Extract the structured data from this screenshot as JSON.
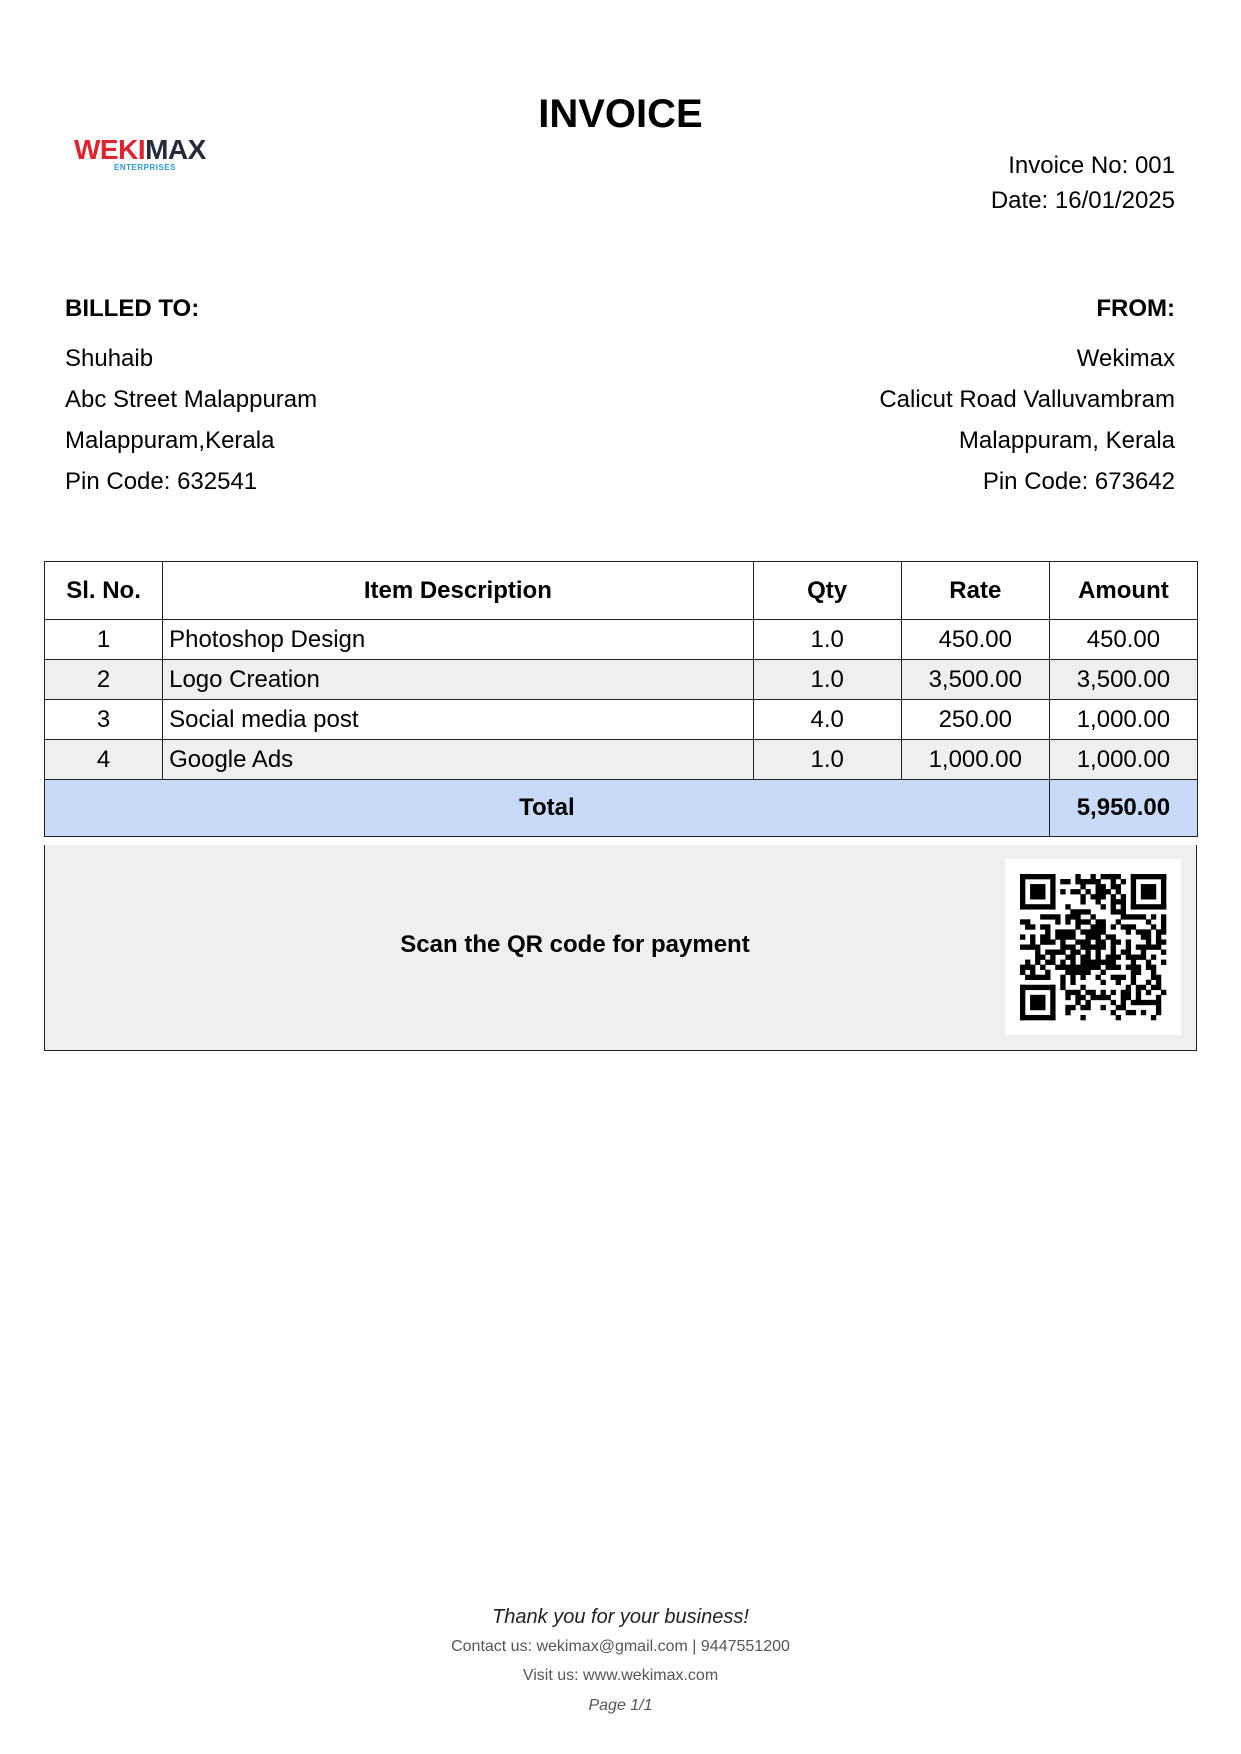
{
  "document": {
    "title": "INVOICE",
    "logo": {
      "text_red": "WEKI",
      "text_dark": "MAX",
      "subtitle": "ENTERPRISES",
      "red_color": "#e0242f",
      "dark_color": "#262b3a",
      "sub_color": "#2d9ad6"
    },
    "invoice_no": "Invoice No: 001",
    "date": "Date: 16/01/2025"
  },
  "billed_to": {
    "heading": "BILLED TO:",
    "name": "Shuhaib",
    "address_line1": "Abc Street Malappuram",
    "address_line2": "Malappuram,Kerala",
    "pin": "Pin Code: 632541"
  },
  "from": {
    "heading": "FROM:",
    "name": "Wekimax",
    "address_line1": "Calicut Road Valluvambram",
    "address_line2": "Malappuram, Kerala",
    "pin": "Pin Code: 673642"
  },
  "table": {
    "headers": {
      "sl": "Sl. No.",
      "desc": "Item Description",
      "qty": "Qty",
      "rate": "Rate",
      "amount": "Amount"
    },
    "rows": [
      {
        "sl": "1",
        "desc": "Photoshop Design",
        "qty": "1.0",
        "rate": "450.00",
        "amount": "450.00"
      },
      {
        "sl": "2",
        "desc": "Logo Creation",
        "qty": "1.0",
        "rate": "3,500.00",
        "amount": "3,500.00"
      },
      {
        "sl": "3",
        "desc": "Social media post",
        "qty": "4.0",
        "rate": "250.00",
        "amount": "1,000.00"
      },
      {
        "sl": "4",
        "desc": "Google Ads",
        "qty": "1.0",
        "rate": "1,000.00",
        "amount": "1,000.00"
      }
    ],
    "total_label": "Total",
    "total_value": "5,950.00",
    "total_row_color": "#c9daf8",
    "alt_row_color": "#efefef"
  },
  "payment": {
    "qr_text": "Scan the QR code for payment",
    "qr_icon": "qr-code-icon"
  },
  "footer": {
    "thanks": "Thank you for your business!",
    "contact": "Contact us: wekimax@gmail.com | 9447551200",
    "visit": "Visit us: www.wekimax.com",
    "page": "Page 1/1"
  }
}
